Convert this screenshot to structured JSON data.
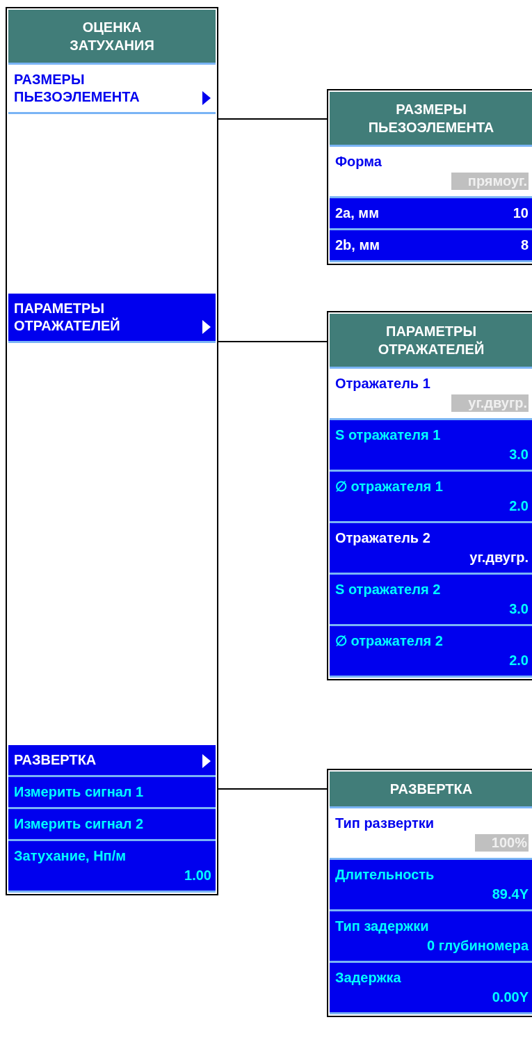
{
  "main_menu": {
    "title": "ОЦЕНКА\nЗАТУХАНИЯ",
    "items": [
      {
        "kind": "submenu",
        "label": "РАЗМЕРЫ\nПЬЕЗОЭЛЕМЕНТА",
        "selected": true
      },
      {
        "kind": "submenu",
        "label": "ПАРАМЕТРЫ\nОТРАЖАТЕЛЕЙ",
        "selected": false
      },
      {
        "kind": "submenu",
        "label": "РАЗВЕРТКА",
        "selected": false
      },
      {
        "kind": "action",
        "label": "Измерить сигнал 1",
        "selected": false
      },
      {
        "kind": "action",
        "label": "Измерить сигнал 2",
        "selected": false
      },
      {
        "kind": "number",
        "label": "Затухание, Нп/м",
        "value": "1.00",
        "selected": false
      }
    ]
  },
  "submenus": [
    {
      "title": "РАЗМЕРЫ\nПЬЕЗОЭЛЕМЕНТА",
      "items": [
        {
          "kind": "choice",
          "label": "Форма",
          "value": "прямоуг.",
          "selected": true
        },
        {
          "kind": "size",
          "label": "2a, мм",
          "value": "10",
          "selected": false
        },
        {
          "kind": "size",
          "label": "2b, мм",
          "value": "8",
          "selected": false
        }
      ]
    },
    {
      "title": "ПАРАМЕТРЫ\nОТРАЖАТЕЛЕЙ",
      "items": [
        {
          "kind": "choice",
          "label": "Отражатель 1",
          "value": "уг.двугр.",
          "selected": true
        },
        {
          "kind": "number",
          "label": "S отражателя 1",
          "value": "3.0",
          "selected": false
        },
        {
          "kind": "number",
          "label": "∅ отражателя 1",
          "value": "2.0",
          "selected": false
        },
        {
          "kind": "choice",
          "label": "Отражатель 2",
          "value": "уг.двугр.",
          "selected": false
        },
        {
          "kind": "number",
          "label": "S отражателя 2",
          "value": "3.0",
          "selected": false
        },
        {
          "kind": "number",
          "label": "∅ отражателя 2",
          "value": "2.0",
          "selected": false
        }
      ]
    },
    {
      "title": "РАЗВЕРТКА",
      "items": [
        {
          "kind": "choice",
          "label": "Тип развертки",
          "value": "100%",
          "selected": true
        },
        {
          "kind": "number",
          "label": "Длительность",
          "value": "89.4Y",
          "selected": false
        },
        {
          "kind": "number",
          "label": "Тип задержки",
          "value": "0 глубиномера",
          "selected": false
        },
        {
          "kind": "number",
          "label": "Задержка",
          "value": "0.00Y",
          "selected": false
        }
      ]
    }
  ]
}
